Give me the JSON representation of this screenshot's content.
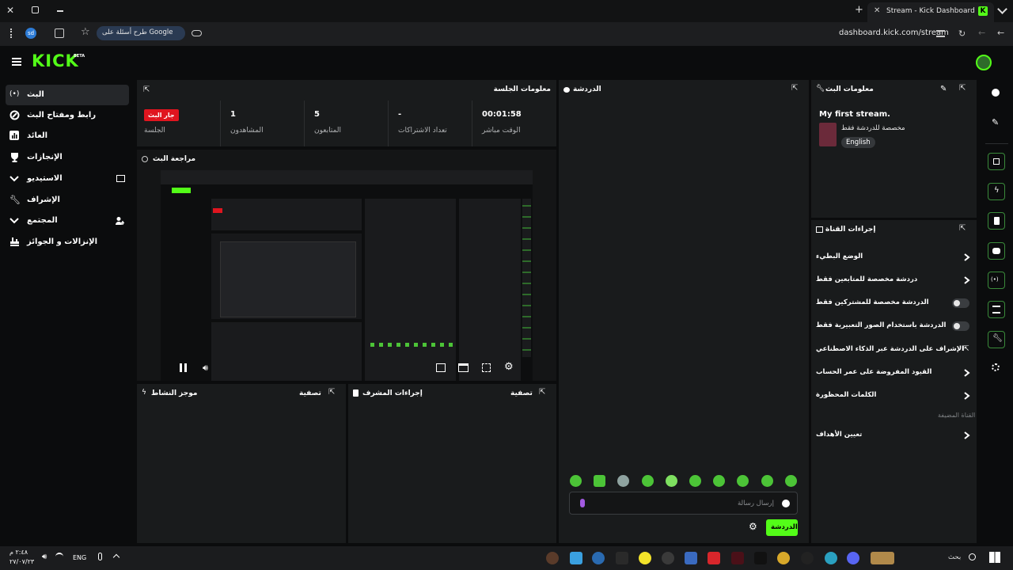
{
  "browser": {
    "tab_title": "Stream - Kick Dashboard",
    "url": "dashboard.kick.com/stream",
    "search_chip": "طرح أسئلة على Google",
    "profile_initials": "sd",
    "new_tab_symbol": "+",
    "close_symbol": "✕"
  },
  "kick": {
    "logo": "KICK",
    "logo_badge": "BETA"
  },
  "sidebar": {
    "items": [
      {
        "label": "البث",
        "icon": "broadcast-icon"
      },
      {
        "label": "رابط ومفتاح البث",
        "icon": "link-icon"
      },
      {
        "label": "العائد",
        "icon": "chart-icon"
      },
      {
        "label": "الإنجازات",
        "icon": "trophy-icon"
      },
      {
        "label": "الاستيديو",
        "icon": "chevron-down-icon"
      },
      {
        "label": "الإشراف",
        "icon": "wrench-icon"
      },
      {
        "label": "المجتمع",
        "icon": "chevron-down-icon"
      },
      {
        "label": "الإنزالات و الجوائز",
        "icon": "gift-icon"
      }
    ]
  },
  "session": {
    "title": "معلومات الجلسة",
    "live_badge": "جار البث",
    "stats": [
      {
        "label": "الجلسة",
        "value": ""
      },
      {
        "label": "المشاهدون",
        "value": "1"
      },
      {
        "label": "المتابعون",
        "value": "5"
      },
      {
        "label": "تعداد الاشتراكات",
        "value": "-"
      },
      {
        "label": "الوقت مباشر",
        "value": "00:01:58"
      }
    ]
  },
  "preview": {
    "title": "مراجعة البث"
  },
  "activity": {
    "title": "موجز النشاط",
    "filter": "تصفية"
  },
  "modactions": {
    "title": "إجراءات المشرف",
    "filter": "تصفية"
  },
  "chat": {
    "title": "الدردشة",
    "placeholder": "إرسال رسالة",
    "send_label": "الدردشة"
  },
  "streaminfo": {
    "title": "معلومات البث",
    "stream_title": "My first stream.",
    "category": "مخصصة للدردشة فقط",
    "language": "English"
  },
  "channelactions": {
    "title": "إجراءات القناة",
    "rows": [
      {
        "label": "الوضع البطيء",
        "control": "chevron"
      },
      {
        "label": "دردشة مخصصة للمتابعين فقط",
        "control": "chevron"
      },
      {
        "label": "الدردشة مخصصة للمشتركين فقط",
        "control": "toggle"
      },
      {
        "label": "الدردشة باستخدام الصور التعبيرية فقط",
        "control": "toggle"
      },
      {
        "label": "الإشراف على الدردشة عبر الذكاء الاصطناعي",
        "control": "external"
      },
      {
        "label": "القيود المفروضة على عمر الحساب",
        "control": "chevron"
      },
      {
        "label": "الكلمات المحظورة",
        "control": "chevron"
      }
    ],
    "section_label": "القناة المضيفة",
    "targets_label": "تعيين الأهداف"
  },
  "taskbar": {
    "search_label": "بحث",
    "lang": "ENG",
    "time": "٢:٤٨ م",
    "date": "٢٧/٠٧/٢٣"
  },
  "colors": {
    "kick_green": "#53fc18",
    "live_red": "#e0151f",
    "panel_bg": "#191b1c"
  }
}
